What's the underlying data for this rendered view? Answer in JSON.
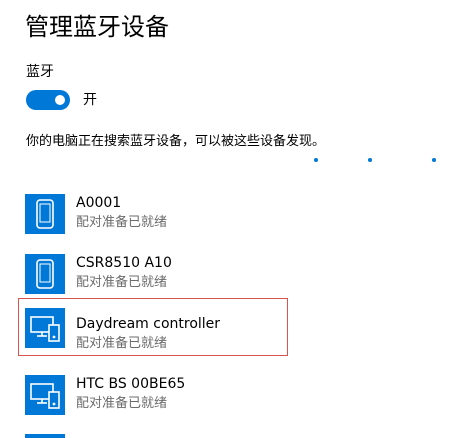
{
  "page": {
    "title": "管理蓝牙设备"
  },
  "bluetooth": {
    "label": "蓝牙",
    "toggle_state": "开",
    "toggle_on": true
  },
  "status": {
    "text": "你的电脑正在搜索蓝牙设备，可以被这些设备发现。"
  },
  "devices": [
    {
      "name": "A0001",
      "status": "配对准备已就绪",
      "icon": "phone-icon",
      "selected": false
    },
    {
      "name": "CSR8510 A10",
      "status": "配对准备已就绪",
      "icon": "phone-icon",
      "selected": false
    },
    {
      "name": "Daydream controller",
      "status": "配对准备已就绪",
      "icon": "computer-icon",
      "selected": true
    },
    {
      "name": "HTC BS 00BE65",
      "status": "配对准备已就绪",
      "icon": "computer-icon",
      "selected": false
    }
  ],
  "colors": {
    "accent": "#0078d7",
    "selection_border": "#d9534f",
    "secondary_text": "#6b6b6b"
  }
}
